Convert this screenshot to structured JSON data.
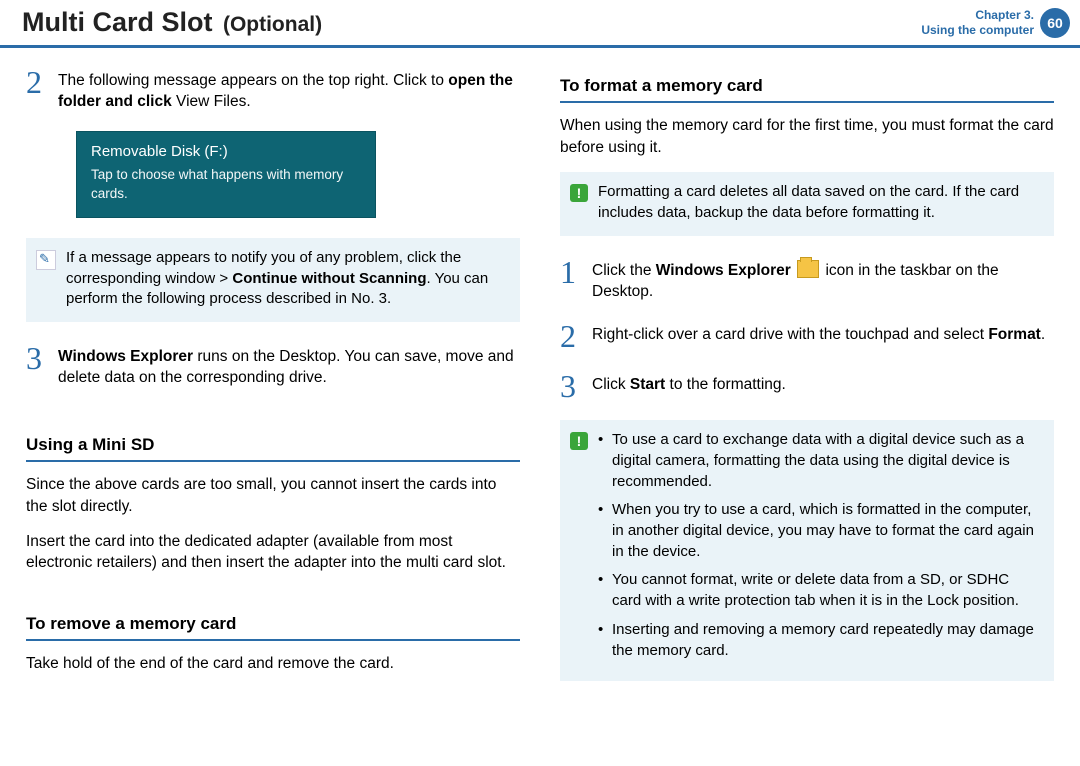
{
  "header": {
    "title_main": "Multi Card Slot",
    "title_optional": "(Optional)",
    "chapter_line1": "Chapter 3.",
    "chapter_line2": "Using the computer",
    "page_number": "60"
  },
  "left": {
    "step2_a": "The following message appears on the top right. Click to ",
    "step2_b": "open the folder and click",
    "step2_c": " View Files.",
    "autoplay_title": "Removable Disk (F:)",
    "autoplay_sub": "Tap to choose what happens with memory cards.",
    "note1_a": "If a message appears to notify you of any problem, click the corresponding window > ",
    "note1_b": "Continue without Scanning",
    "note1_c": ". You can perform the following process described in No. 3.",
    "step3_a": "Windows Explorer",
    "step3_b": " runs on the Desktop. You can save, move and delete data on the corresponding drive.",
    "sub_mini": "Using a Mini SD",
    "mini_p1": "Since the above cards are too small, you cannot insert the cards into the slot directly.",
    "mini_p2": "Insert the card into the dedicated adapter (available from most electronic retailers) and then insert the adapter into the multi card slot.",
    "sub_remove": "To remove a memory card",
    "remove_p": "Take hold of the end of the card and remove the card."
  },
  "right": {
    "sub_format": "To format a memory card",
    "format_intro": "When using the memory card for the first time, you must format the card before using it.",
    "warn1": "Formatting a card deletes all data saved on the card. If the card includes data, backup the data before formatting it.",
    "r_step1_a": "Click the ",
    "r_step1_b": "Windows Explorer",
    "r_step1_c": " icon in the taskbar on the Desktop.",
    "r_step2_a": "Right-click over a card drive with the touchpad and select ",
    "r_step2_b": "Format",
    "r_step2_c": ".",
    "r_step3_a": "Click ",
    "r_step3_b": "Start",
    "r_step3_c": " to the formatting.",
    "note_bullets": {
      "b1": "To use a card to exchange data with a digital device such as a digital camera, formatting the data using the digital device is recommended.",
      "b2": "When you try to use a card, which is formatted in the computer, in another digital device, you may have to format the card again in the device.",
      "b3": "You cannot format, write or delete data from a SD, or SDHC card with a write protection tab when it is in the Lock position.",
      "b4": "Inserting and removing a memory card repeatedly may damage the memory card."
    }
  }
}
